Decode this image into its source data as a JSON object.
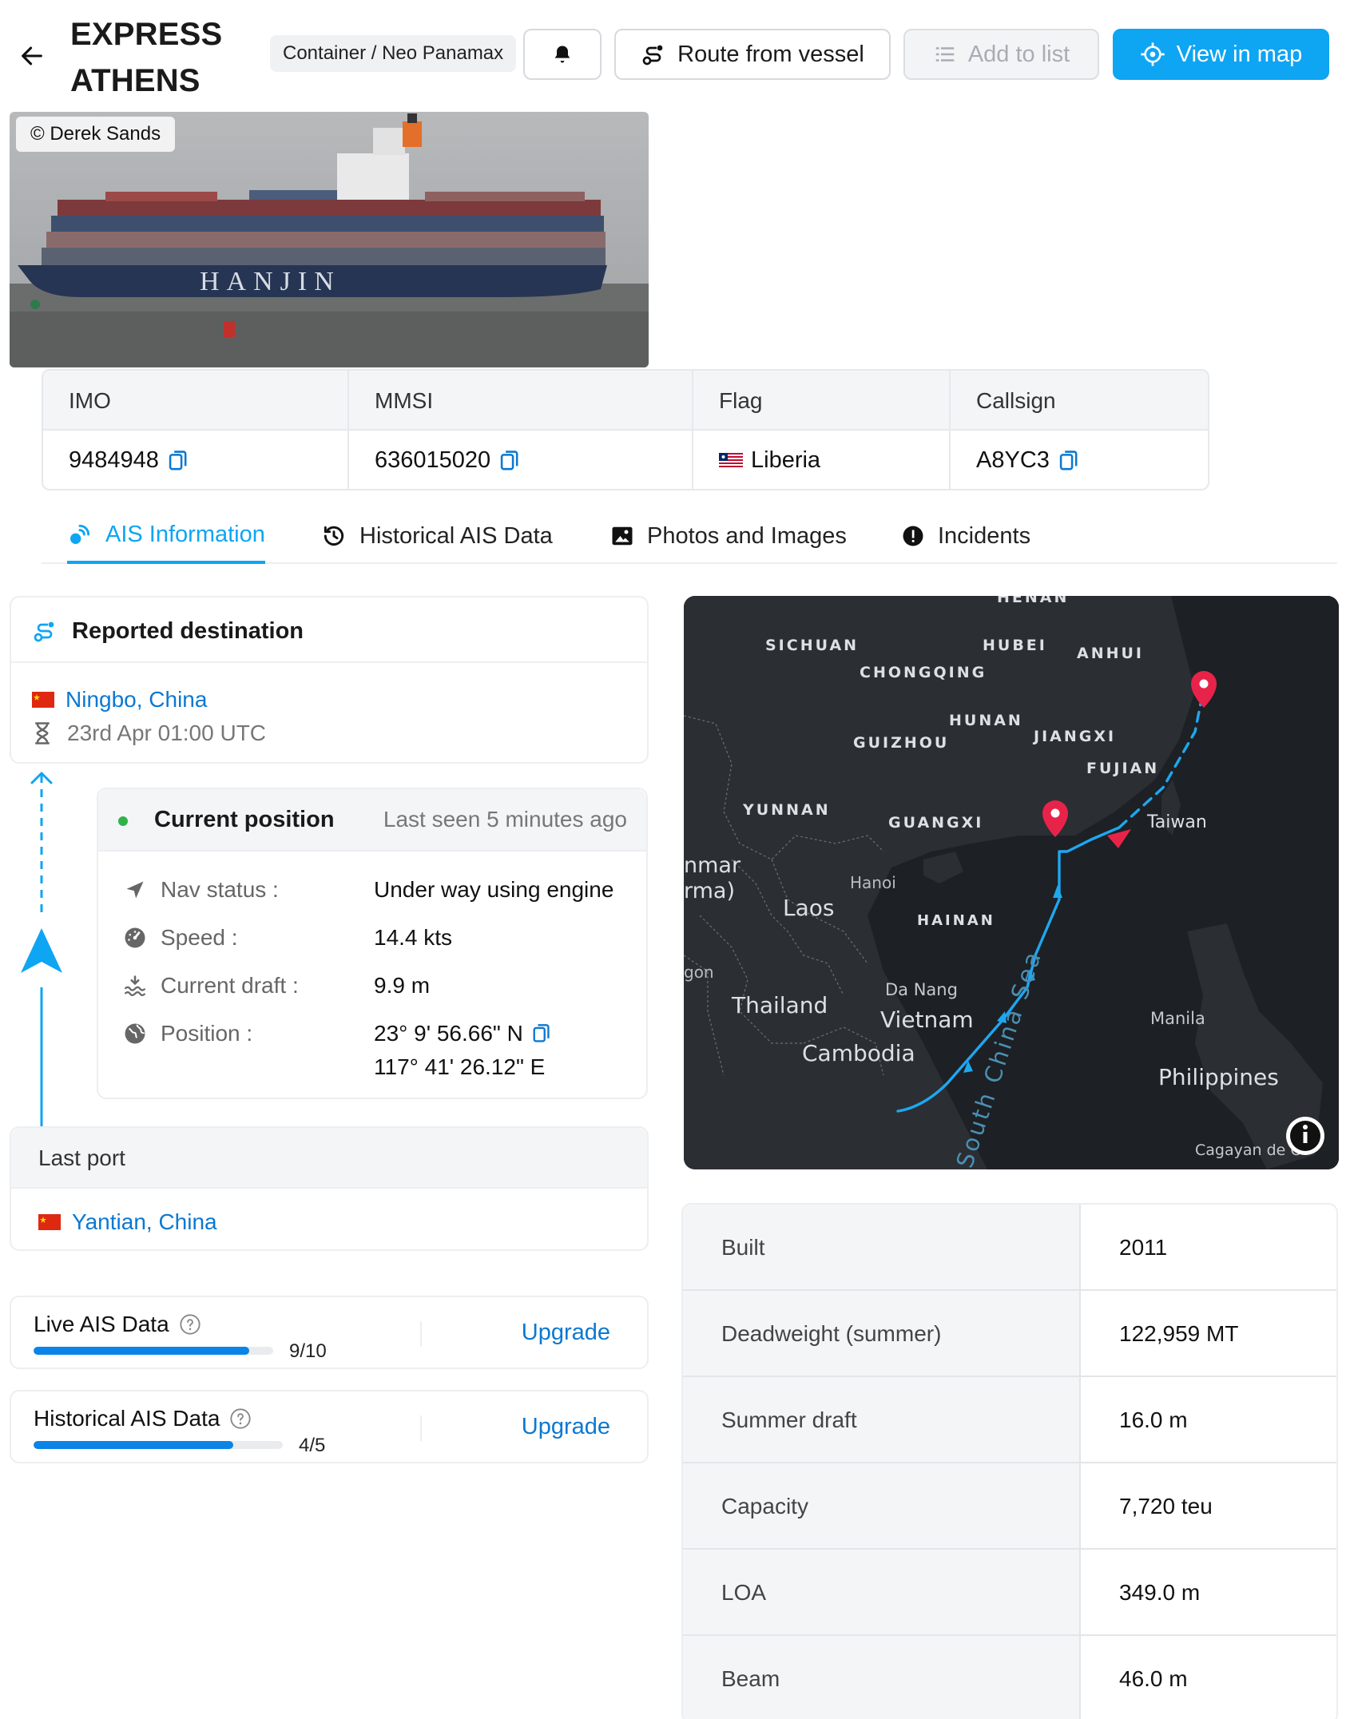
{
  "vessel": {
    "name_line1": "EXPRESS",
    "name_line2": "ATHENS",
    "type": "Container / Neo Panamax"
  },
  "toolbar": {
    "route_label": "Route from vessel",
    "add_list_label": "Add to list",
    "view_map_label": "View in map"
  },
  "photo": {
    "credit": "© Derek Sands",
    "hull_text": "HANJIN"
  },
  "ids": {
    "imo_label": "IMO",
    "imo": "9484948",
    "mmsi_label": "MMSI",
    "mmsi": "636015020",
    "flag_label": "Flag",
    "flag": "Liberia",
    "callsign_label": "Callsign",
    "callsign": "A8YC3"
  },
  "tabs": [
    {
      "label": "AIS Information"
    },
    {
      "label": "Historical AIS Data"
    },
    {
      "label": "Photos and Images"
    },
    {
      "label": "Incidents"
    }
  ],
  "destination": {
    "title": "Reported destination",
    "port": "Ningbo, China",
    "eta": "23rd Apr 01:00 UTC"
  },
  "position": {
    "title": "Current position",
    "last_seen": "Last seen 5 minutes ago",
    "nav_status_label": "Nav status :",
    "nav_status": "Under way using engine",
    "speed_label": "Speed :",
    "speed": "14.4 kts",
    "draft_label": "Current draft :",
    "draft": "9.9 m",
    "position_label": "Position :",
    "lat": "23° 9' 56.66\" N",
    "lon": "117° 41' 26.12\" E"
  },
  "last_port": {
    "title": "Last port",
    "port": "Yantian, China"
  },
  "quotas": [
    {
      "label": "Live AIS Data",
      "count": "9/10",
      "fraction": 0.9,
      "action": "Upgrade"
    },
    {
      "label": "Historical AIS Data",
      "count": "4/5",
      "fraction": 0.8,
      "action": "Upgrade"
    }
  ],
  "map": {
    "labels": {
      "henan": "HENAN",
      "sichuan": "SICHUAN",
      "hubei": "HUBEI",
      "anhui": "ANHUI",
      "chongqing": "CHONGQING",
      "hunan": "HUNAN",
      "jiangxi": "JIANGXI",
      "guizhou": "GUIZHOU",
      "fujian": "FUJIAN",
      "yunnan": "YUNNAN",
      "guangxi": "GUANGXI",
      "taiwan": "Taiwan",
      "myanmar1": "nmar",
      "myanmar2": "rma)",
      "hanoi": "Hanoi",
      "laos": "Laos",
      "hainan": "HAINAN",
      "gon": "gon",
      "thailand": "Thailand",
      "danang": "Da Nang",
      "vietnam": "Vietnam",
      "cambodia": "Cambodia",
      "scs": "South China Sea",
      "manila": "Manila",
      "philippines": "Philippines",
      "cagayan": "Cagayan de O"
    },
    "route_color": "#1ea7f0",
    "pin_color": "#e8234a"
  },
  "specs": [
    {
      "key": "Built",
      "value": "2011"
    },
    {
      "key": "Deadweight (summer)",
      "value": "122,959 MT"
    },
    {
      "key": "Summer draft",
      "value": "16.0 m"
    },
    {
      "key": "Capacity",
      "value": "7,720 teu"
    },
    {
      "key": "LOA",
      "value": "349.0 m"
    },
    {
      "key": "Beam",
      "value": "46.0 m"
    }
  ]
}
